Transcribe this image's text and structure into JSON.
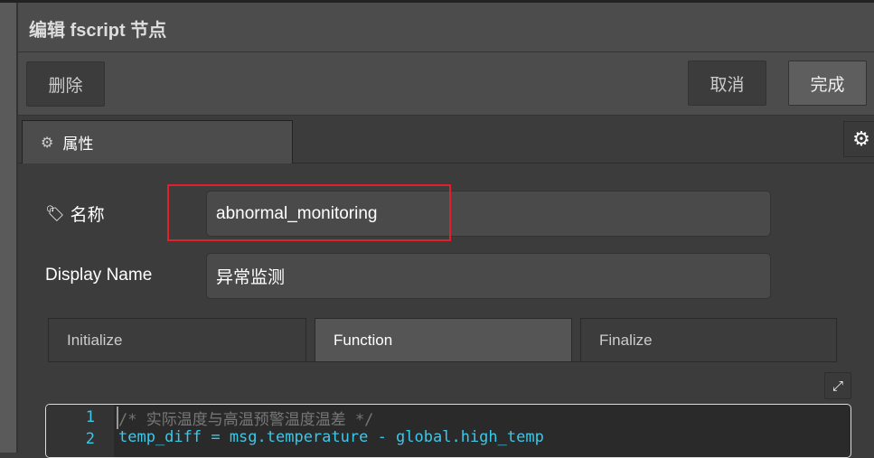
{
  "dialog": {
    "title": "编辑 fscript 节点"
  },
  "toolbar": {
    "delete_label": "删除",
    "cancel_label": "取消",
    "done_label": "完成"
  },
  "tabs": {
    "properties_label": "属性"
  },
  "form": {
    "name_label": "名称",
    "name_value": "abnormal_monitoring",
    "display_name_label": "Display Name",
    "display_name_value": "异常监测"
  },
  "editor_tabs": [
    {
      "label": "Initialize"
    },
    {
      "label": "Function",
      "active": true
    },
    {
      "label": "Finalize"
    }
  ],
  "code": {
    "lines": [
      {
        "num": "1",
        "text": "/* 实际温度与高温预警温度温差 */"
      },
      {
        "num": "2",
        "text": "temp_diff = msg.temperature - global.high_temp"
      }
    ]
  },
  "colors": {
    "highlight_box": "#e0202a",
    "line_number": "#3cc8e8",
    "code_text": "#3cc8e8",
    "comment": "#777777"
  }
}
